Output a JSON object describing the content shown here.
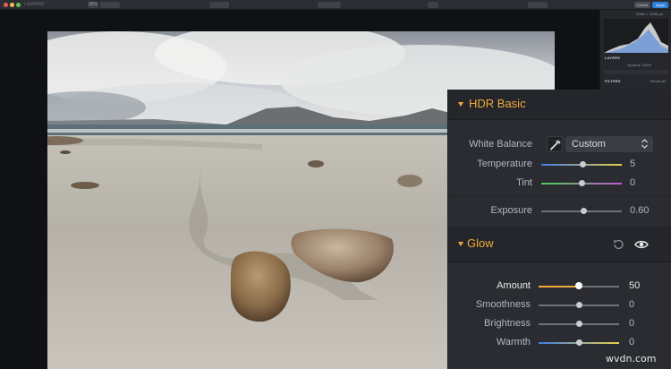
{
  "toolbar": {
    "app_title": "LUMINAR",
    "zoom": "36%",
    "cancel_label": "Cancel",
    "apply_label": "Apply"
  },
  "sidebar": {
    "image_info": "3066 × 2048 px",
    "layers_label": "LAYERS",
    "opacity_label": "Opacity 100%",
    "filters_label": "FILTERS",
    "reset_label": "Reset All",
    "active_filter": "HDR Basic"
  },
  "panel": {
    "hdr": {
      "title": "HDR Basic",
      "white_balance_label": "White Balance",
      "white_balance_value": "Custom",
      "temperature_label": "Temperature",
      "temperature_value": "5",
      "temperature_fraction": 0.52,
      "tint_label": "Tint",
      "tint_value": "0",
      "tint_fraction": 0.5,
      "exposure_label": "Exposure",
      "exposure_value": "0.60",
      "exposure_fraction": 0.53
    },
    "glow": {
      "title": "Glow",
      "amount_label": "Amount",
      "amount_value": "50",
      "amount_fraction": 0.5,
      "smoothness_label": "Smoothness",
      "smoothness_value": "0",
      "smoothness_fraction": 0.5,
      "brightness_label": "Brightness",
      "brightness_value": "0",
      "brightness_fraction": 0.5,
      "warmth_label": "Warmth",
      "warmth_value": "0",
      "warmth_fraction": 0.5
    }
  },
  "colors": {
    "accent": "#f0a93a",
    "panel_bg": "#2a2c31",
    "apply_blue": "#2f7fd8"
  },
  "watermark": "wvdn.com",
  "icons": [
    "eyedropper-icon",
    "chevron-updown-icon",
    "reset-icon",
    "eye-icon"
  ]
}
